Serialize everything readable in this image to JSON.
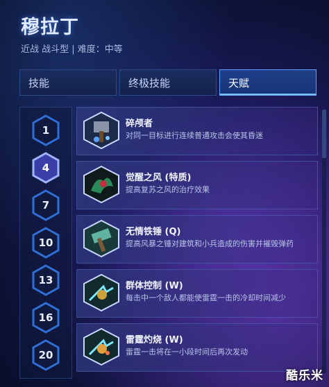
{
  "hero": {
    "name": "穆拉丁",
    "subtitle": "近战 战斗型 | 难度：中等"
  },
  "tabs": [
    {
      "label": "技能",
      "active": false
    },
    {
      "label": "终极技能",
      "active": false
    },
    {
      "label": "天赋",
      "active": true
    }
  ],
  "levels": [
    {
      "label": "1",
      "selected": false
    },
    {
      "label": "4",
      "selected": true
    },
    {
      "label": "7",
      "selected": false
    },
    {
      "label": "10",
      "selected": false
    },
    {
      "label": "13",
      "selected": false
    },
    {
      "label": "16",
      "selected": false
    },
    {
      "label": "20",
      "selected": false
    }
  ],
  "talents": [
    {
      "name": "碎颅者",
      "desc": "对同一目标进行连续普通攻击会使其昏迷",
      "icon": "skull-crusher-icon"
    },
    {
      "name": "觉醒之风 (特质)",
      "desc": "提高复苏之风的治疗效果",
      "icon": "second-wind-icon"
    },
    {
      "name": "无情铁锤 (Q)",
      "desc": "提高风暴之锤对建筑和小兵造成的伤害并摧毁弹药",
      "icon": "storm-hammer-icon"
    },
    {
      "name": "群体控制 (W)",
      "desc": "每击中一个敌人都能使雷霆一击的冷却时间减少",
      "icon": "thunderclap-icon"
    },
    {
      "name": "雷霆灼烧 (W)",
      "desc": "雷霆一击将在一小段时间后再次发动",
      "icon": "thunderclap-burn-icon"
    }
  ],
  "watermark": "酷乐米",
  "colors": {
    "accent": "#5aa0ff",
    "hex_border": "#2f6fd6",
    "hex_selected": "#9fb4ff"
  }
}
